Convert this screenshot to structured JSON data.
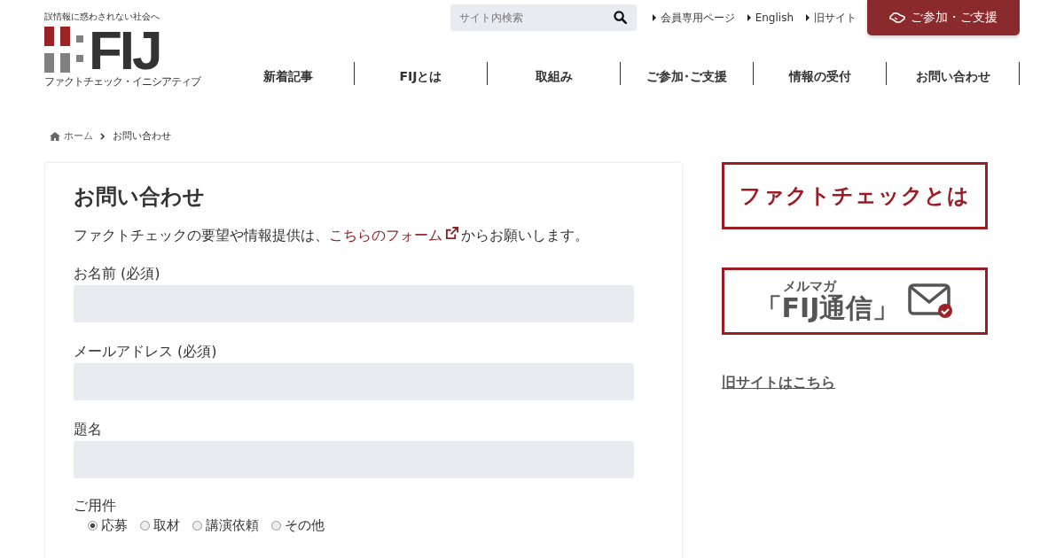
{
  "header": {
    "tagline": "誤情報に惑わされない社会へ",
    "logo_text": "FIJ",
    "logo_subtitle": "ファクトチェック・イニシアティブ",
    "search": {
      "placeholder": "サイト内検索"
    },
    "links": [
      "会員専用ページ",
      "English",
      "旧サイト"
    ],
    "cta": "ご参加・ご支援"
  },
  "nav": [
    {
      "label": "新着記事",
      "selected": false
    },
    {
      "label": "FIJとは",
      "selected": false
    },
    {
      "label": "取組み",
      "selected": false
    },
    {
      "label": "ご参加･ご支援",
      "selected": false
    },
    {
      "label": "情報の受付",
      "selected": false
    },
    {
      "label": "お問い合わせ",
      "selected": false
    }
  ],
  "breadcrumb": [
    "ホーム",
    "お問い合わせ"
  ],
  "form": {
    "title": "お問い合わせ",
    "intro_before": "ファクトチェックの要望や情報提供は、",
    "intro_link": "こちらのフォーム",
    "intro_after": "からお願いします。",
    "fields": [
      {
        "label": "お名前 (必須)"
      },
      {
        "label": "メールアドレス (必須)"
      },
      {
        "label": "題名"
      }
    ],
    "purpose": {
      "label": "ご用件",
      "options": [
        {
          "label": "応募",
          "selected": true
        },
        {
          "label": "取材",
          "selected": false
        },
        {
          "label": "講演依頼",
          "selected": false
        },
        {
          "label": "その他",
          "selected": false
        }
      ]
    }
  },
  "sidebar": {
    "factcheck_banner": "ファクトチェックとは",
    "newsletter_banner": {
      "kicker": "メルマガ",
      "title": "「FIJ通信」"
    },
    "old_site_link": "旧サイトはこちら"
  }
}
